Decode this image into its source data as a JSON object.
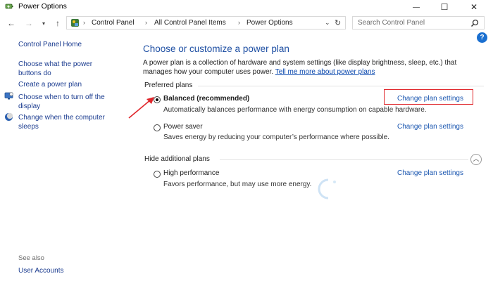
{
  "window": {
    "title": "Power Options",
    "minimize_glyph": "—",
    "maximize_glyph": "☐",
    "close_glyph": "✕"
  },
  "address_bar": {
    "breadcrumbs": [
      "Control Panel",
      "All Control Panel Items",
      "Power Options"
    ],
    "search_placeholder": "Search Control Panel"
  },
  "sidebar": {
    "home_label": "Control Panel Home",
    "items": [
      {
        "label_line1": "Choose what the power",
        "label_line2": "buttons do"
      },
      {
        "label_line1": "Create a power plan",
        "label_line2": ""
      },
      {
        "label_line1": "Choose when to turn off the",
        "label_line2": "display"
      },
      {
        "label_line1": "Change when the computer",
        "label_line2": "sleeps"
      }
    ],
    "see_also_label": "See also",
    "see_also_items": [
      "User Accounts"
    ]
  },
  "main": {
    "heading": "Choose or customize a power plan",
    "intro_text": "A power plan is a collection of hardware and system settings (like display brightness, sleep, etc.) that manages how your computer uses power.",
    "intro_link": "Tell me more about power plans",
    "preferred_label": "Preferred plans",
    "hidden_label": "Hide additional plans",
    "change_label": "Change plan settings",
    "plans": [
      {
        "name": "Balanced (recommended)",
        "description": "Automatically balances performance with energy consumption on capable hardware.",
        "selected": true
      },
      {
        "name": "Power saver",
        "description": "Saves energy by reducing your computer’s performance where possible.",
        "selected": false
      },
      {
        "name": "High performance",
        "description": "Favors performance, but may use more energy.",
        "selected": false
      }
    ]
  },
  "annotations": {
    "highlight_color": "#e0262b",
    "link_color": "#1a56b0",
    "heading_color": "#1e4fa3"
  }
}
